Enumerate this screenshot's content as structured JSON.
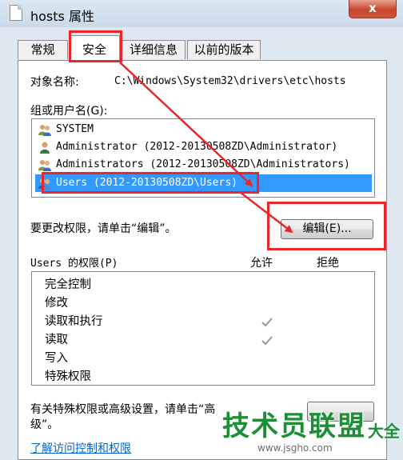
{
  "window": {
    "title": "hosts 属性",
    "close_glyph": "x"
  },
  "tabs": [
    {
      "label": "常规"
    },
    {
      "label": "安全"
    },
    {
      "label": "详细信息"
    },
    {
      "label": "以前的版本"
    }
  ],
  "security": {
    "object_label": "对象名称:",
    "object_value": "C:\\Windows\\System32\\drivers\\etc\\hosts",
    "group_label": "组或用户名(G):",
    "users": [
      {
        "name": "SYSTEM",
        "icon": "group-users-icon"
      },
      {
        "name": "Administrator (2012-20130508ZD\\Administrator)",
        "icon": "user-icon"
      },
      {
        "name": "Administrators (2012-20130508ZD\\Administrators)",
        "icon": "group-users-icon"
      },
      {
        "name": "Users (2012-20130508ZD\\Users)",
        "icon": "group-users-icon",
        "selected": true
      }
    ],
    "change_hint": "要更改权限，请单击“编辑”。",
    "edit_button": "编辑(E)...",
    "permissions_header": "Users 的权限(P)",
    "allow_header": "允许",
    "deny_header": "拒绝",
    "permissions": [
      {
        "name": "完全控制",
        "allow": false,
        "deny": false
      },
      {
        "name": "修改",
        "allow": false,
        "deny": false
      },
      {
        "name": "读取和执行",
        "allow": true,
        "deny": false
      },
      {
        "name": "读取",
        "allow": true,
        "deny": false
      },
      {
        "name": "写入",
        "allow": false,
        "deny": false
      },
      {
        "name": "特殊权限",
        "allow": false,
        "deny": false
      }
    ],
    "special_hint_line1": "有关特殊权限或高级设置，请单击“高",
    "special_hint_line2": "级”。",
    "help_link": "了解访问控制和权限"
  },
  "watermark": {
    "title": "技术员联盟",
    "suffix": "大全",
    "url": "www.jsgho.com"
  },
  "colors": {
    "annotation_red": "#e8262b",
    "selection_blue": "#3399ff",
    "check_gray": "#9a9a9a",
    "watermark_green": "#1c8f36"
  }
}
